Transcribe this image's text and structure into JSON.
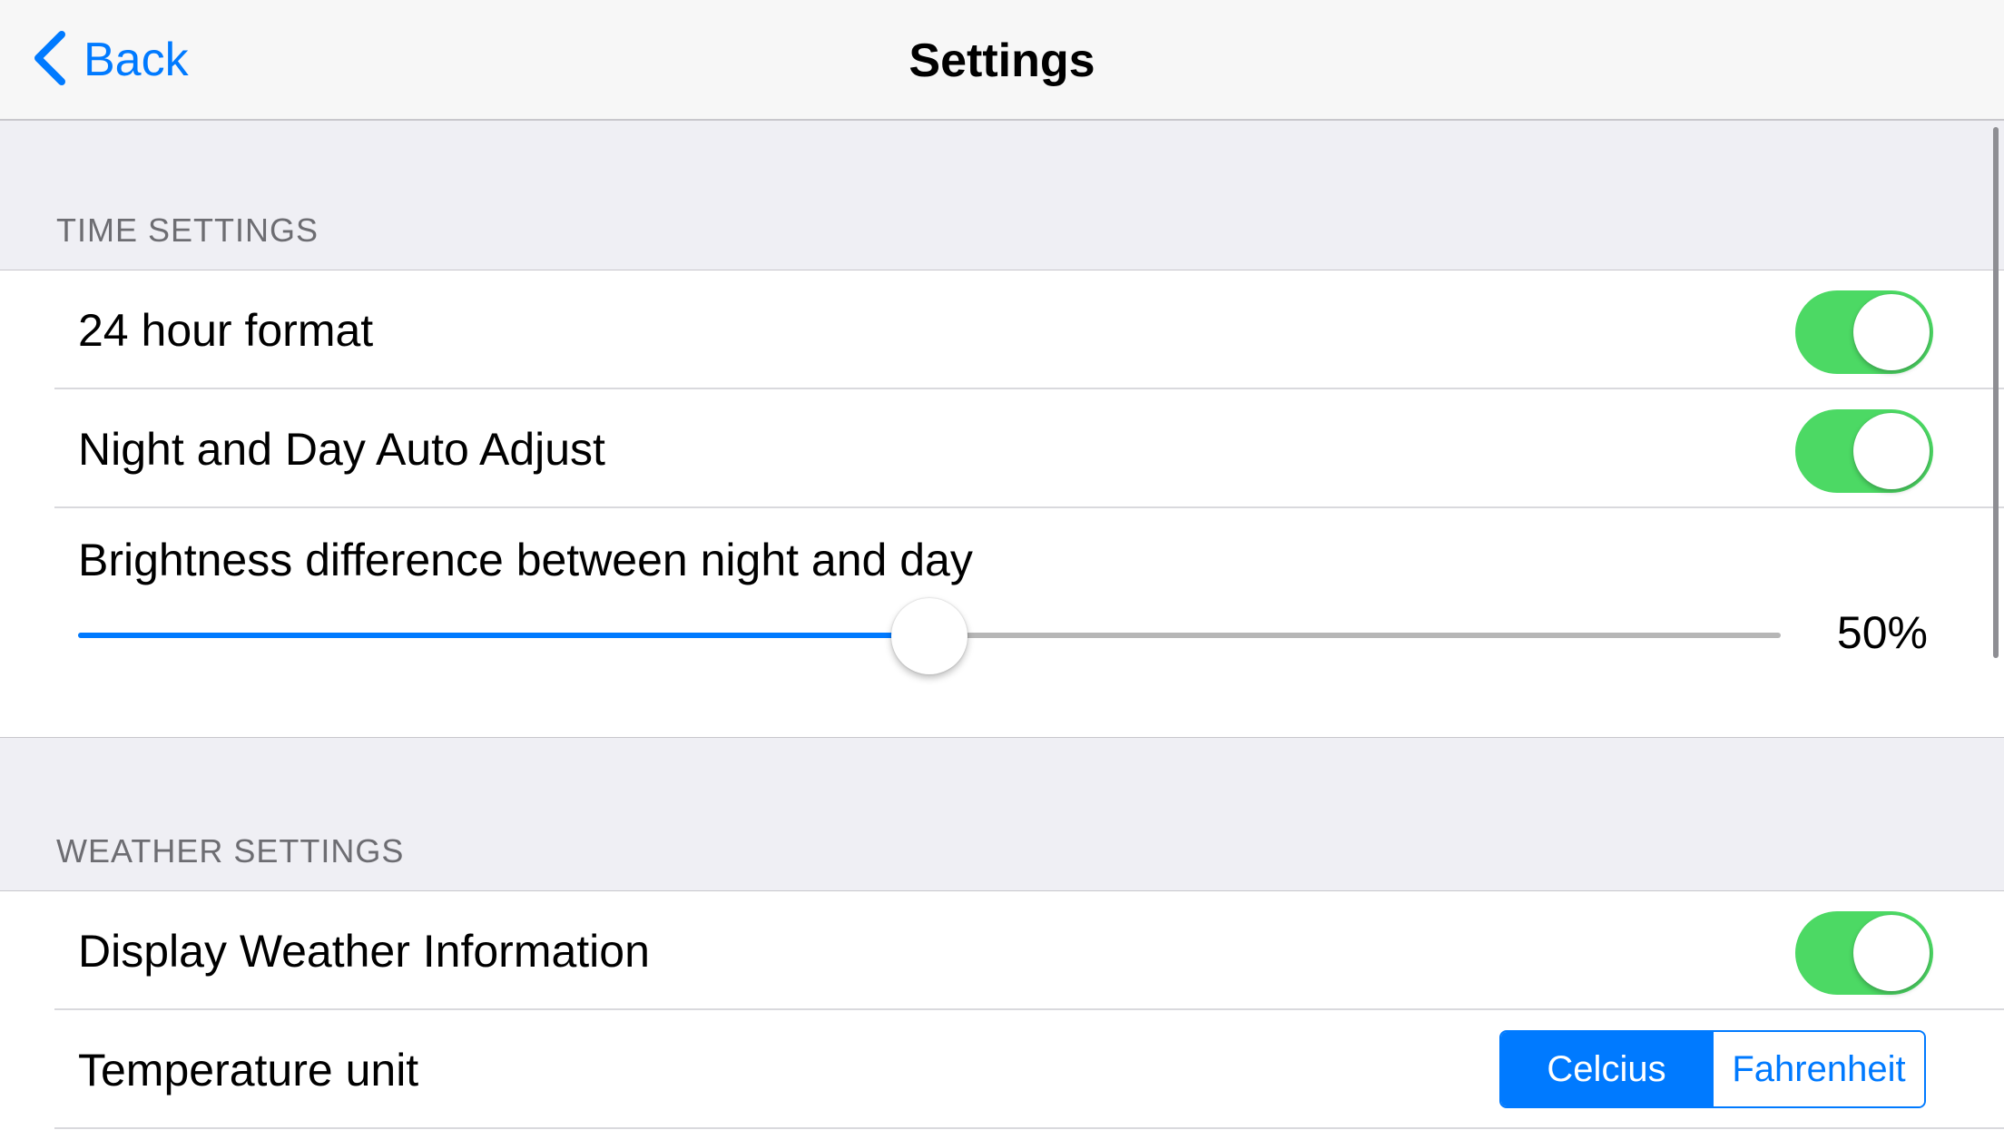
{
  "nav": {
    "back_label": "Back",
    "title": "Settings"
  },
  "time_settings": {
    "header": "TIME SETTINGS",
    "rows": [
      {
        "label": "24 hour format",
        "on": true
      },
      {
        "label": "Night and Day Auto Adjust",
        "on": true
      }
    ],
    "brightness": {
      "label": "Brightness difference between night and day",
      "value": 0.5,
      "value_text": "50%"
    }
  },
  "weather_settings": {
    "header": "WEATHER SETTINGS",
    "display_weather": {
      "label": "Display Weather Information",
      "on": true
    },
    "temperature_unit": {
      "label": "Temperature unit",
      "options": [
        "Celcius",
        "Fahrenheit"
      ],
      "selected": "Celcius"
    }
  },
  "colors": {
    "accent": "#007aff",
    "toggle_on": "#4cd964",
    "background": "#efeff4"
  }
}
